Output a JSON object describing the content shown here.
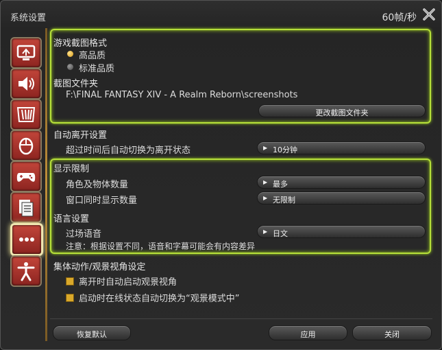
{
  "window": {
    "title": "系统设置",
    "fps": "60帧/秒"
  },
  "sidebar": {
    "items": [
      {
        "icon": "monitor-icon"
      },
      {
        "icon": "speaker-icon"
      },
      {
        "icon": "hud-icon"
      },
      {
        "icon": "mouse-icon"
      },
      {
        "icon": "gamepad-icon"
      },
      {
        "icon": "log-icon"
      },
      {
        "icon": "more-icon",
        "active": true
      },
      {
        "icon": "accessibility-icon"
      }
    ]
  },
  "screenshot": {
    "heading": "游戏截图格式",
    "options": [
      {
        "label": "高品质",
        "selected": true
      },
      {
        "label": "标准品质",
        "selected": false
      }
    ],
    "folder_heading": "截图文件夹",
    "folder_path": "F:\\FINAL FANTASY XIV - A Realm Reborn\\screenshots",
    "change_button": "更改截图文件夹"
  },
  "afk": {
    "heading": "自动离开设置",
    "label": "超过时间后自动切换为离开状态",
    "value": "10分钟"
  },
  "display_limit": {
    "heading": "显示限制",
    "chars_label": "角色及物体数量",
    "chars_value": "最多",
    "windows_label": "窗口同时显示数量",
    "windows_value": "无限制"
  },
  "language": {
    "heading": "语言设置",
    "cutscene_label": "过场语音",
    "cutscene_value": "日文",
    "note": "注意：根据设置不同，语音和字幕可能会有内容差异"
  },
  "group_pose": {
    "heading": "集体动作/观景视角设定",
    "options": [
      {
        "label": "离开时自动启动观景视角",
        "checked": true
      },
      {
        "label": "启动时在线状态自动切换为“观景模式中”",
        "checked": true
      }
    ]
  },
  "footer": {
    "reset": "恢复默认",
    "apply": "应用",
    "close": "关闭"
  }
}
